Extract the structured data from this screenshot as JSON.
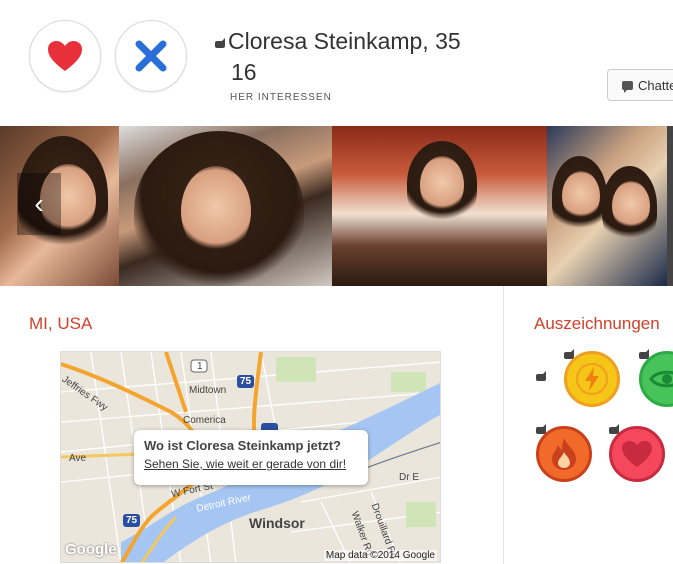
{
  "profile": {
    "name_age": "Cloresa Steinkamp, 35",
    "count": "16",
    "interests_label": "HER INTERESSEN"
  },
  "actions": {
    "like_icon": "heart-icon",
    "nope_icon": "x-icon",
    "chat_label": "Chatte"
  },
  "photos": {
    "prev_arrow": "‹"
  },
  "location": {
    "title": "MI, USA",
    "map": {
      "labels": {
        "jeffries": "Jeffries Fwy",
        "midtown": "Midtown",
        "comerica": "Comerica",
        "ave": "Ave",
        "fort": "W Fort St",
        "river": "Detroit River",
        "windsor": "Windsor",
        "drouillard": "Drouillard Rd",
        "walker": "Walker Rd",
        "drE": "Dr E",
        "hwy1": "1",
        "hwy75a": "75",
        "hwy75b": "75"
      },
      "popup_question": "Wo ist Cloresa Steinkamp jetzt?",
      "popup_link": "Sehen Sie, wie weit er gerade von dir!",
      "credit": "Map data ©2014 Google",
      "logo": "Google"
    }
  },
  "awards": {
    "title": "Auszeichnungen",
    "badges": [
      "lightning-badge",
      "eye-badge",
      "fire-badge",
      "heart-badge"
    ]
  },
  "colors": {
    "accent": "#d0402a",
    "heart": "#e8303a",
    "x": "#2a6ed8"
  }
}
